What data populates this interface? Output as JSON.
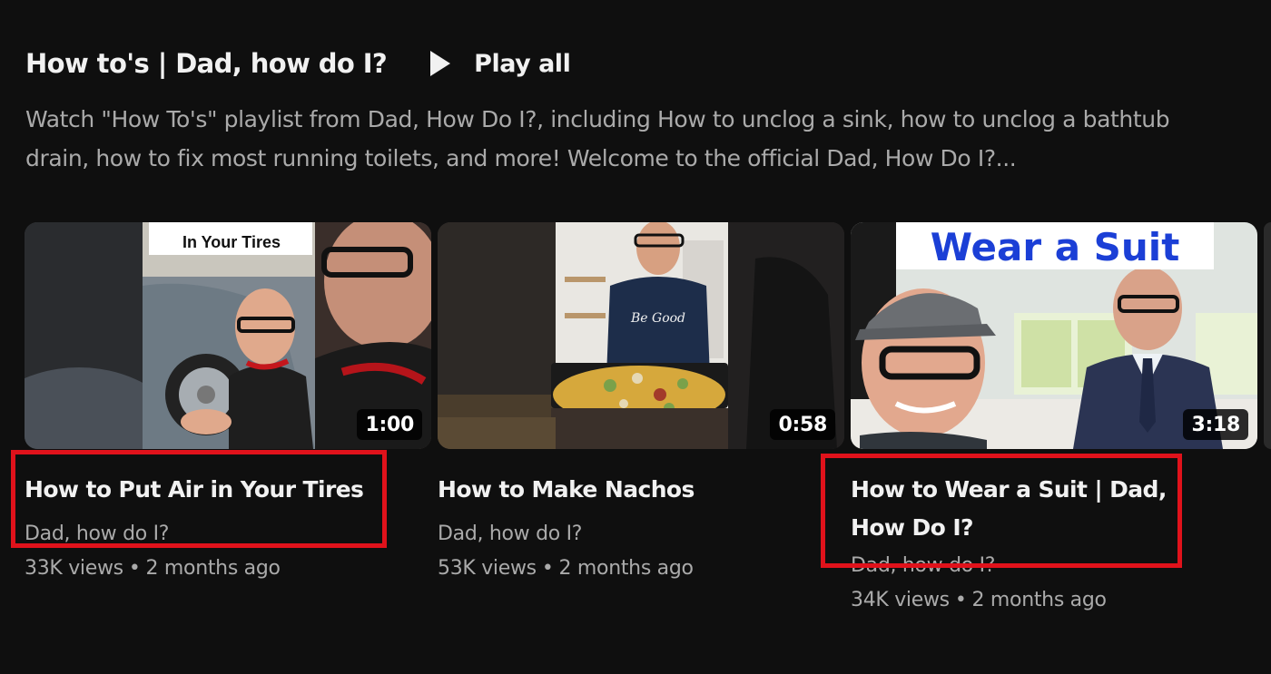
{
  "shelf": {
    "title": "How to's | Dad, how do I?",
    "play_all_label": "Play all",
    "description": "Watch \"How To's\" playlist from Dad, How Do I?, including How to unclog a sink, how to unclog a bathtub drain, how to fix most running toilets, and more! Welcome to the official Dad, How Do I?..."
  },
  "videos": [
    {
      "title": "How to Put Air in Your Tires",
      "channel": "Dad, how do I?",
      "views": "33K views",
      "age": "2 months ago",
      "duration": "1:00",
      "thumb_caption": "In Your Tires"
    },
    {
      "title": "How to Make Nachos",
      "channel": "Dad, how do I?",
      "views": "53K views",
      "age": "2 months ago",
      "duration": "0:58"
    },
    {
      "title": "How to Wear a Suit | Dad, How Do I?",
      "channel": "Dad, how do I?",
      "views": "34K views",
      "age": "2 months ago",
      "duration": "3:18",
      "thumb_caption": "Wear a Suit"
    }
  ],
  "colors": {
    "background": "#0f0f0f",
    "primary_text": "#f1f1f1",
    "secondary_text": "#aaaaaa",
    "highlight_box": "#e0121b",
    "thumb_caption_blue": "#1b3fd6"
  }
}
